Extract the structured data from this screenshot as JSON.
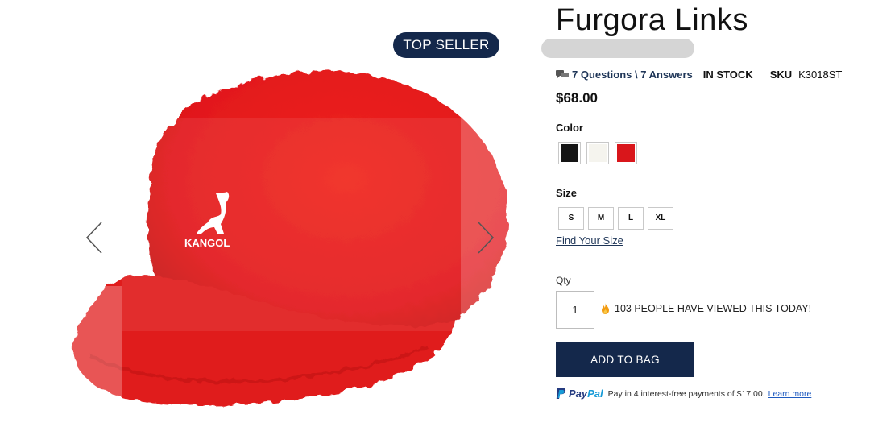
{
  "gallery": {
    "badge": "TOP SELLER",
    "logo_text": "KANGOL",
    "colors": {
      "hat": "#e41a1c",
      "hat_dark": "#b90f12"
    }
  },
  "product": {
    "title": "Furgora Links",
    "qa_text": "7 Questions \\ 7 Answers",
    "stock": "IN STOCK",
    "sku_label": "SKU",
    "sku_value": "K3018ST",
    "price": "$68.00",
    "color_label": "Color",
    "colors": [
      {
        "name": "Black",
        "hex": "#151515"
      },
      {
        "name": "White",
        "hex": "#f5f4ee"
      },
      {
        "name": "Red",
        "hex": "#d9161b"
      }
    ],
    "size_label": "Size",
    "sizes": [
      "S",
      "M",
      "L",
      "XL"
    ],
    "find_size": "Find Your Size",
    "qty_label": "Qty",
    "qty_value": "1",
    "viewed_text": "103 PEOPLE HAVE VIEWED THIS TODAY!",
    "add_to_bag": "ADD TO BAG",
    "paypal": {
      "pay": "Pay",
      "pal": "Pal",
      "message": "Pay in 4 interest-free payments of $17.00.",
      "learn_more": "Learn more"
    }
  }
}
